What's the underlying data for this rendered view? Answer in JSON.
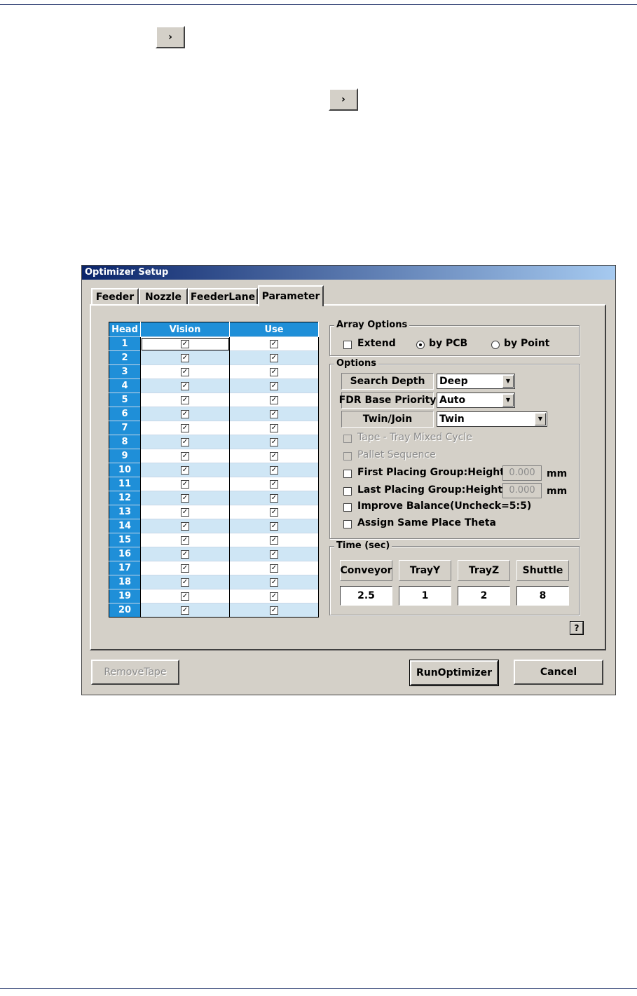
{
  "doc": {
    "arrow1": "›",
    "arrow2": "›"
  },
  "dialog": {
    "title": "Optimizer Setup",
    "tabs": [
      "Feeder",
      "Nozzle",
      "FeederLane",
      "Parameter"
    ],
    "active_tab": "Parameter"
  },
  "grid": {
    "headers": [
      "Head",
      "Vision",
      "Use"
    ],
    "rows": [
      "1",
      "2",
      "3",
      "4",
      "5",
      "6",
      "7",
      "8",
      "9",
      "10",
      "11",
      "12",
      "13",
      "14",
      "15",
      "16",
      "17",
      "18",
      "19",
      "20"
    ],
    "check": "✓"
  },
  "array_options": {
    "title": "Array Options",
    "extend": "Extend",
    "by_pcb": "by PCB",
    "by_point": "by Point",
    "selected": "by PCB"
  },
  "options": {
    "title": "Options",
    "search_depth_label": "Search Depth",
    "search_depth_value": "Deep",
    "fdr_label": "FDR Base Priority",
    "fdr_value": "Auto",
    "twin_label": "Twin/Join",
    "twin_value": "Twin",
    "tape_tray": "Tape - Tray Mixed Cycle",
    "pallet": "Pallet Sequence",
    "first_placing": "First Placing Group:Height <=",
    "first_value": "0.000",
    "last_placing": "Last Placing Group:Height >=",
    "last_value": "0.000",
    "unit": "mm",
    "improve": "Improve Balance(Uncheck=5:5)",
    "assign": "Assign Same Place Theta"
  },
  "time": {
    "title": "Time (sec)",
    "headers": [
      "Conveyor",
      "TrayY",
      "TrayZ",
      "Shuttle"
    ],
    "values": [
      "2.5",
      "1",
      "2",
      "8"
    ]
  },
  "buttons": {
    "remove_tape": "RemoveTape",
    "run": "RunOptimizer",
    "cancel": "Cancel",
    "help": "?"
  },
  "colors": {
    "title_start": "#0a246a",
    "title_end": "#a6caf0",
    "grid_header": "#1f8fd8",
    "row_alt": "#cfe6f5"
  }
}
